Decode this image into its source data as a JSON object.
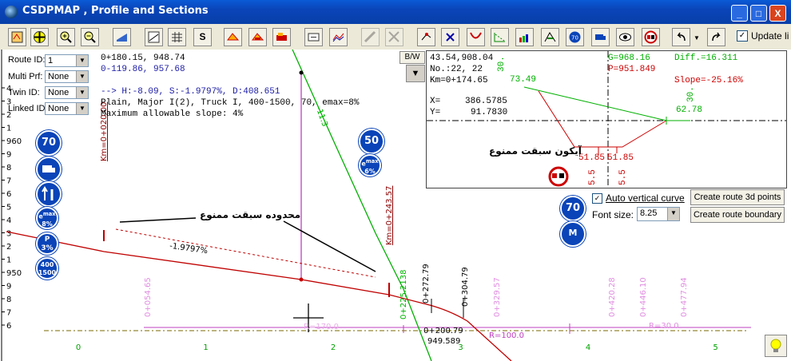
{
  "window": {
    "title": "CSDPMAP , Profile and Sections",
    "minimize": "_",
    "maximize": "□",
    "close": "X"
  },
  "toolbar": {
    "s_label": "S",
    "update_label": "Update li",
    "update_checked": "✓",
    "icons": [
      "settings-icon",
      "pan-icon",
      "zoom-in-icon",
      "zoom-out-icon",
      "layers-icon",
      "grade-icon",
      "grid-icon",
      "section-icon",
      "vehicle-icon",
      "vehicle-alt-icon",
      "truck-icon",
      "text-icon",
      "profile-icon",
      "ruler-icon",
      "ruler-alt-icon",
      "edit-icon",
      "delete-icon",
      "curve-icon",
      "slope-icon",
      "speed-bars-icon",
      "signs-icon",
      "speed-70-icon",
      "truck-sign-icon",
      "view-icon",
      "no-overtaking-icon",
      "undo-icon",
      "redo-icon"
    ]
  },
  "left_panel": {
    "route": {
      "label": "Route ID:",
      "value": "1"
    },
    "multi": {
      "label": "Multi Prf:",
      "value": "None"
    },
    "twin": {
      "label": "Twin ID:",
      "value": "None"
    },
    "linked": {
      "label": "Linked ID:",
      "value": "None"
    }
  },
  "info": {
    "line1": "0+180.15, 948.74",
    "line2": "0-119.86, 957.68",
    "line3": "--> H:-8.09, S:-1.9797%, D:408.651",
    "line4": "Plain, Major I(2), Truck I, 400-1500, 70, emax=8%",
    "line5": "Maximum allowable slope: 4%"
  },
  "bw": {
    "label": "B/W",
    "arrow": "▼"
  },
  "section": {
    "coords": "43.54,908.04",
    "no": "No.:22, 22",
    "km": "Km=0+174.65",
    "x_label": "X=",
    "x_val": "386.5785",
    "y_label": "Y=",
    "y_val": "91.7830",
    "g": "G=968.16",
    "p": "P=951.849",
    "diff": "Diff.=16.311",
    "slope": "Slope=-25.16%",
    "left_elev": "73.49",
    "right_elev": "62.78",
    "left_vert": "30.",
    "right_vert": "30.",
    "bottom1": "51.85",
    "bottom2": "51.85",
    "v55a": "5.5",
    "v55b": "5.5",
    "note": "آیکون سبقت ممنوع"
  },
  "options": {
    "auto_curve_label": "Auto vertical curve",
    "auto_curve_checked": "✓",
    "font_size_label": "Font size:",
    "font_size_value": "8.25",
    "route3d_button": "Create route 3d points",
    "boundary_button": "Create route boundary"
  },
  "profile": {
    "y_ticks": [
      "4",
      "3",
      "2",
      "1",
      "960",
      "9",
      "8",
      "7",
      "6",
      "5",
      "4",
      "3",
      "2",
      "1",
      "950",
      "9",
      "8",
      "7",
      "6"
    ],
    "x_ticks": [
      "0",
      "1",
      "2",
      "3",
      "4",
      "5"
    ],
    "stations_pink": [
      "0+054.65",
      "0+329.57",
      "0+420.28",
      "0+446.10",
      "0+477.94"
    ],
    "stations_black": [
      "0+272.79",
      "0+304.79"
    ],
    "stations_green": [
      "0+225.2138"
    ],
    "km_labels": [
      "Km=0+020.00",
      "Km=0+243.57"
    ],
    "slope_label": "-1.9797%",
    "curve_label_1": "0+200.79",
    "curve_label_2": "949.589",
    "r_label_1": "R=100.0",
    "r_label_2": "R=30.0",
    "r_label_3": "R=170.0",
    "green_label": "-11.3",
    "annotation": "محدوده سبقت ممنوع",
    "signs": {
      "speed": "70",
      "speed2": "50",
      "speed3": "70",
      "slope_top": "e",
      "slope_max": "max",
      "slope_val": "6%",
      "e8_top": "e",
      "e8_max": "max",
      "e8_val": "8%",
      "p_label": "P",
      "p_val": "3%",
      "range1": "400",
      "range2": "1500",
      "two_lane": "2",
      "m": "M"
    }
  },
  "colors": {
    "profile": "#c00000",
    "ground": "#00b000",
    "guide": "#c040c0",
    "sign": "#0a44b8"
  }
}
